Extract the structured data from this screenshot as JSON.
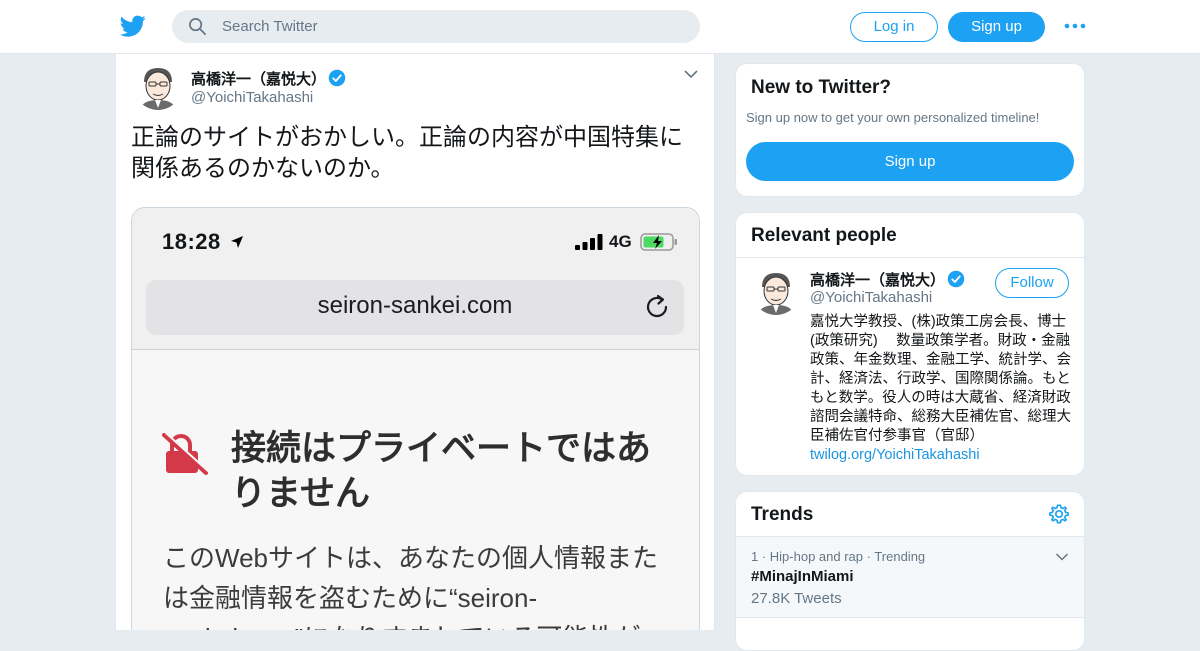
{
  "header": {
    "search_placeholder": "Search Twitter",
    "login_label": "Log in",
    "signup_label": "Sign up",
    "brand_color": "#1da1f2"
  },
  "tweet": {
    "author_name": "高橋洋一（嘉悦大）",
    "author_handle": "@YoichiTakahashi",
    "verified": true,
    "text": "正論のサイトがおかしい。正論の内容が中国特集に関係あるのかないのか。",
    "screenshot": {
      "time": "18:28",
      "network": "4G",
      "url": "seiron-sankei.com",
      "title": "接続はプライベートではありません",
      "body": "このWebサイトは、あなたの個人情報または金融情報を盗むために“seiron-sankei.com”になりすましている可能性が"
    }
  },
  "new_to_twitter": {
    "title": "New to Twitter?",
    "subtitle": "Sign up now to get your own personalized timeline!",
    "button_label": "Sign up"
  },
  "relevant_people": {
    "title": "Relevant people",
    "person": {
      "name": "高橋洋一（嘉悦大）",
      "handle": "@YoichiTakahashi",
      "follow_label": "Follow",
      "bio": "嘉悦大学教授、(株)政策工房会長、博士(政策研究)　 数量政策学者。財政・金融政策、年金数理、金融工学、統計学、会計、経済法、行政学、国際関係論。もともと数学。役人の時は大蔵省、経済財政諮問会議特命、総務大臣補佐官、総理大臣補佐官付参事官（官邸）",
      "bio_link": "twilog.org/YoichiTakahashi"
    }
  },
  "trends": {
    "title": "Trends",
    "items": [
      {
        "meta": "1 · Hip-hop and rap · Trending",
        "tag": "#MinajInMiami",
        "count": "27.8K Tweets"
      }
    ]
  }
}
